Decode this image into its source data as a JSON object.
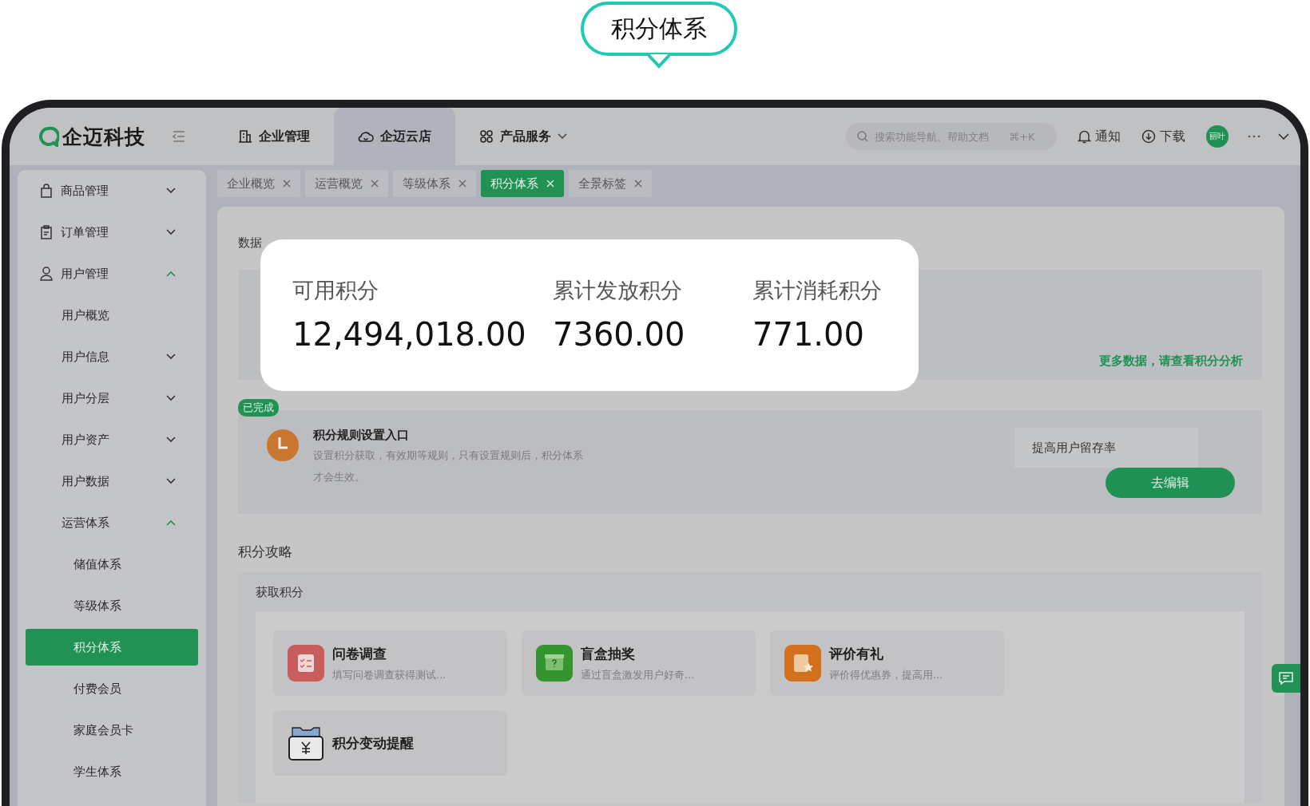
{
  "callout": {
    "title": "积分体系"
  },
  "header": {
    "logo": "企迈科技",
    "top_nav": [
      {
        "label": "企业管理",
        "kind": "building",
        "selected": false
      },
      {
        "label": "企迈云店",
        "kind": "cloud",
        "selected": true
      },
      {
        "label": "产品服务",
        "kind": "apps",
        "selected": false
      }
    ],
    "search": {
      "placeholder": "搜索功能导航、帮助文档",
      "shortcut": "⌘+K"
    },
    "actions": [
      {
        "label": "通知",
        "kind": "bell"
      },
      {
        "label": "下载",
        "kind": "download"
      }
    ],
    "avatar": "丽叶"
  },
  "tabs": [
    {
      "label": "企业概览",
      "selected": false
    },
    {
      "label": "运营概览",
      "selected": false
    },
    {
      "label": "等级体系",
      "selected": false
    },
    {
      "label": "积分体系",
      "selected": true
    },
    {
      "label": "全景标签",
      "selected": false
    }
  ],
  "sidebar": {
    "items": [
      {
        "label": "商品管理",
        "kind": "bag",
        "expanded": false
      },
      {
        "label": "订单管理",
        "kind": "clipboard",
        "expanded": false
      },
      {
        "label": "用户管理",
        "kind": "person",
        "expanded": true,
        "children": [
          {
            "label": "用户概览",
            "selected": false
          },
          {
            "label": "用户信息",
            "selected": false,
            "expanded": false
          },
          {
            "label": "用户分层",
            "selected": false,
            "expanded": false
          },
          {
            "label": "用户资产",
            "selected": false,
            "expanded": false
          },
          {
            "label": "用户数据",
            "selected": false,
            "expanded": false
          },
          {
            "label": "运营体系",
            "selected": false,
            "expanded": true,
            "children": [
              {
                "label": "储值体系",
                "selected": false
              },
              {
                "label": "等级体系",
                "selected": false
              },
              {
                "label": "积分体系",
                "selected": true
              },
              {
                "label": "付费会员",
                "selected": false
              },
              {
                "label": "家庭会员卡",
                "selected": false
              },
              {
                "label": "学生体系",
                "selected": false
              }
            ]
          }
        ]
      }
    ]
  },
  "data_overview": {
    "title": "数据",
    "link": "更多数据，请查看积分分析",
    "stats": [
      {
        "label": "可用积分",
        "value": "12,494,018.00"
      },
      {
        "label": "累计发放积分",
        "value": "7360.00"
      },
      {
        "label": "累计消耗积分",
        "value": "771.00"
      }
    ]
  },
  "task": {
    "badge": "已完成",
    "title": "积分规则设置入口",
    "description": "设置积分获取，有效期等规则，只有设置规则后，积分体系才会生效。",
    "tag": "提高用户留存率",
    "button": "去编辑"
  },
  "strategy": {
    "title": "积分攻略",
    "subtitle": "获取积分",
    "cards": [
      {
        "title": "问卷调查",
        "description": "填写问卷调查获得测试...",
        "kind": "survey"
      },
      {
        "title": "盲盒抽奖",
        "description": "通过盲盒激发用户好奇...",
        "kind": "box"
      },
      {
        "title": "评价有礼",
        "description": "评价得优惠券，提高用...",
        "kind": "review"
      },
      {
        "title": "积分变动提醒",
        "kind": "wallet"
      }
    ]
  }
}
